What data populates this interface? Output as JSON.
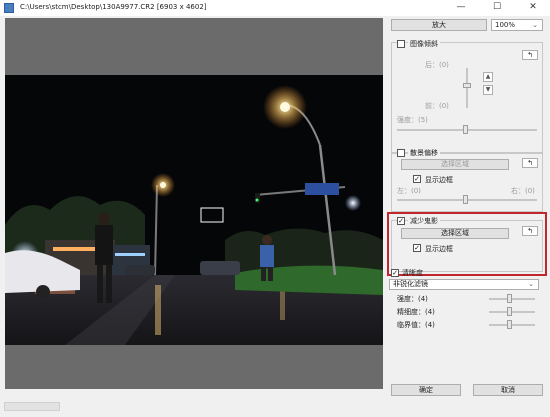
{
  "window": {
    "title": "C:\\Users\\stcm\\Desktop\\130A9977.CR2 [6903 x 4602]",
    "minimize": "—",
    "maximize": "☐",
    "close": "✕"
  },
  "toolbar": {
    "zoom_button": "放大",
    "zoom_value": "100%",
    "zoom_arrow": "⌄"
  },
  "image_tilt": {
    "label": "图像倾斜",
    "checked": false,
    "rear": "后：(0)",
    "front": "前：(0)",
    "strength": "强度：(5)"
  },
  "background_shift": {
    "label": "散景偏移",
    "checked": false,
    "select_area": "选择区域",
    "show_border": "显示边框",
    "left": "左：(0)",
    "right": "右：(0)"
  },
  "reduce_ghosting": {
    "label": "减少鬼影",
    "checked": true,
    "select_area": "选择区域",
    "show_border": "显示边框",
    "show_border_checked": true
  },
  "sharpness": {
    "label": "清晰度",
    "checked": true,
    "filter": "非锐化滤镜",
    "strength": "强度：(4)",
    "fineness": "精细度：(4)",
    "threshold": "临界值：(4)"
  },
  "footer": {
    "ok": "确定",
    "cancel": "取消"
  },
  "icons": {
    "reset": "↰",
    "up": "▲",
    "down": "▼",
    "check": "✓"
  }
}
